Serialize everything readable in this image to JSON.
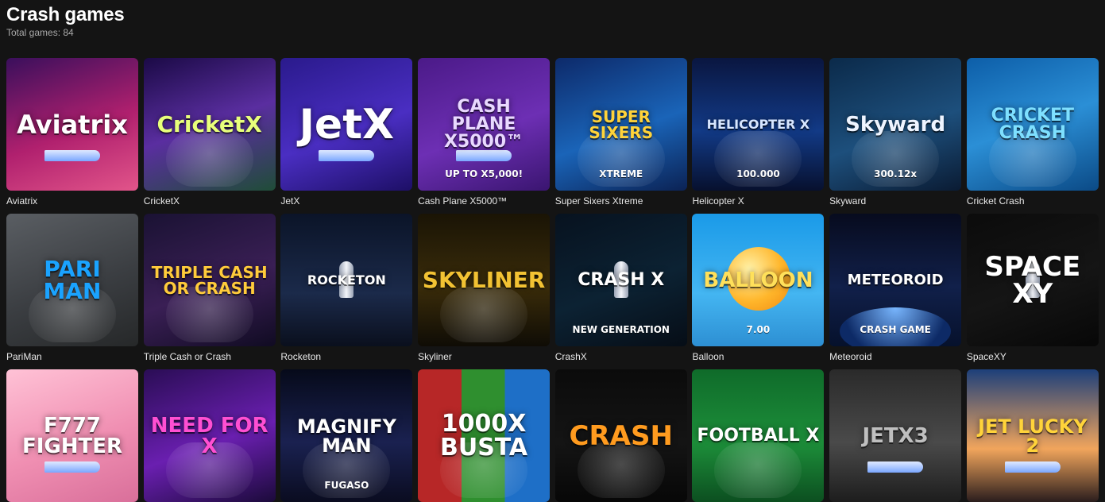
{
  "page": {
    "title": "Crash games",
    "total_label": "Total games: 84"
  },
  "games": [
    {
      "name": "Aviatrix",
      "thumb_text": "Aviatrix",
      "thumb_sub": "",
      "bg": "linear-gradient(160deg,#3a0f5c 0%,#b0206e 55%,#e2558a 100%)",
      "text_color": "#ffffff",
      "font_size": "32px",
      "icon": "plane-icon"
    },
    {
      "name": "CricketX",
      "thumb_text": "CricketX",
      "thumb_sub": "",
      "bg": "linear-gradient(160deg,#1b0a46 0%,#5a2ea0 50%,#1f4d37 100%)",
      "text_color": "#e8ff7a",
      "font_size": "28px",
      "icon": "cricket-bat-icon"
    },
    {
      "name": "JetX",
      "thumb_text": "JetX",
      "thumb_sub": "",
      "bg": "linear-gradient(160deg,#2a1a8c 0%,#4a2ec2 55%,#1d0f66 100%)",
      "text_color": "#ffffff",
      "font_size": "52px",
      "icon": "jet-icon"
    },
    {
      "name": "Cash Plane X5000™",
      "thumb_text": "CASH PLANE X5000™",
      "thumb_sub": "UP TO X5,000!",
      "bg": "linear-gradient(160deg,#4b1a88 0%,#6d2fb4 55%,#3a1570 100%)",
      "text_color": "#e9d9ff",
      "font_size": "22px",
      "icon": "plane-icon"
    },
    {
      "name": "Super Sixers Xtreme",
      "thumb_text": "SUPER SIXERS",
      "thumb_sub": "XTREME",
      "bg": "linear-gradient(160deg,#0d2a6a 0%,#1a64b8 55%,#0b2254 100%)",
      "text_color": "#ffd33a",
      "font_size": "20px",
      "icon": "cricket-ball-icon"
    },
    {
      "name": "Helicopter X",
      "thumb_text": "HELICOPTER X",
      "thumb_sub": "100.000",
      "bg": "linear-gradient(180deg,#0a1640 0%,#123a86 55%,#07102e 100%)",
      "text_color": "#d7e6ff",
      "font_size": "16px",
      "icon": "helicopter-icon"
    },
    {
      "name": "Skyward",
      "thumb_text": "Skyward",
      "thumb_sub": "300.12x",
      "bg": "linear-gradient(160deg,#0b2a4a 0%,#1d4f7c 55%,#0a1b33 100%)",
      "text_color": "#eef4ff",
      "font_size": "26px",
      "icon": "pilot-icon"
    },
    {
      "name": "Cricket Crash",
      "thumb_text": "CRICKET CRASH",
      "thumb_sub": "",
      "bg": "linear-gradient(160deg,#0d5ea8 0%,#2b8fd6 50%,#0b4a86 100%)",
      "text_color": "#7ee0ff",
      "font_size": "22px",
      "icon": "helmet-icon"
    },
    {
      "name": "PariMan",
      "thumb_text": "PARI MAN",
      "thumb_sub": "",
      "bg": "linear-gradient(160deg,#5a5e63 0%,#3b3e42 55%,#262829 100%)",
      "text_color": "#1aa3ff",
      "font_size": "28px",
      "icon": "hero-icon"
    },
    {
      "name": "Triple Cash or Crash",
      "thumb_text": "TRIPLE CASH OR CRASH",
      "thumb_sub": "",
      "bg": "linear-gradient(160deg,#1a1233 0%,#3a1f55 55%,#100b22 100%)",
      "text_color": "#ffcb3b",
      "font_size": "20px",
      "icon": "astronaut-icon"
    },
    {
      "name": "Rocketon",
      "thumb_text": "ROCKETON",
      "thumb_sub": "",
      "bg": "linear-gradient(180deg,#0b1428 0%,#1b2a4a 60%,#0a0f1d 100%)",
      "text_color": "#ffffff",
      "font_size": "16px",
      "icon": "rocket-icon"
    },
    {
      "name": "Skyliner",
      "thumb_text": "SKYLINER",
      "thumb_sub": "",
      "bg": "linear-gradient(180deg,#1a1405 0%,#3a2c0a 55%,#0f0c05 100%)",
      "text_color": "#f2c233",
      "font_size": "28px",
      "icon": "airship-icon"
    },
    {
      "name": "CrashX",
      "thumb_text": "CRASH X",
      "thumb_sub": "NEW GENERATION",
      "bg": "linear-gradient(160deg,#07121f 0%,#0c2233 55%,#060d16 100%)",
      "text_color": "#ffffff",
      "font_size": "22px",
      "icon": "rocket-icon"
    },
    {
      "name": "Balloon",
      "thumb_text": "BALLOON",
      "thumb_sub": "7.00",
      "bg": "linear-gradient(180deg,#1a9ae8 0%,#44b6f2 60%,#2d8fd3 100%)",
      "text_color": "#ffe05a",
      "font_size": "26px",
      "icon": "balloon-icon"
    },
    {
      "name": "Meteoroid",
      "thumb_text": "METEOROID",
      "thumb_sub": "CRASH GAME",
      "bg": "linear-gradient(180deg,#070b1e 0%,#11204a 55%,#06112c 100%)",
      "text_color": "#ffffff",
      "font_size": "18px",
      "icon": "planet-icon"
    },
    {
      "name": "SpaceXY",
      "thumb_text": "SPACE XY",
      "thumb_sub": "",
      "bg": "linear-gradient(160deg,#0b0b0b 0%,#151515 55%,#070707 100%)",
      "text_color": "#ffffff",
      "font_size": "34px",
      "icon": "rocket-icon"
    },
    {
      "name": "F777 Fighter",
      "thumb_text": "F777 FIGHTER",
      "thumb_sub": "",
      "bg": "linear-gradient(160deg,#ffc2d6 0%,#f08fb2 55%,#d96f9a 100%)",
      "text_color": "#ffffff",
      "font_size": "26px",
      "icon": "jet-icon"
    },
    {
      "name": "Need for X",
      "thumb_text": "NEED FOR X",
      "thumb_sub": "",
      "bg": "linear-gradient(160deg,#2a0d55 0%,#6a1fb0 55%,#1b0a3a 100%)",
      "text_color": "#ff4fd2",
      "font_size": "26px",
      "icon": "car-icon"
    },
    {
      "name": "Magnify Man",
      "thumb_text": "MAGNIFY MAN",
      "thumb_sub": "FUGASO",
      "bg": "linear-gradient(180deg,#060a1a 0%,#1a2150 55%,#0a0c20 100%)",
      "text_color": "#ffffff",
      "font_size": "24px",
      "icon": "hero-icon"
    },
    {
      "name": "1000x Busta",
      "thumb_text": "1000X BUSTA",
      "thumb_sub": "",
      "bg": "linear-gradient(90deg,#b72727 0%,#b72727 33%,#2f8f2f 33%,#2f8f2f 66%,#1e6fc7 66%,#1e6fc7 100%)",
      "text_color": "#ffffff",
      "font_size": "30px",
      "icon": "money-icon"
    },
    {
      "name": "Crash",
      "thumb_text": "CRASH",
      "thumb_sub": "",
      "bg": "linear-gradient(180deg,#0b0b0b 0%,#141414 55%,#070707 100%)",
      "text_color": "#ff9b1f",
      "font_size": "34px",
      "icon": "flame-icon"
    },
    {
      "name": "Football X",
      "thumb_text": "FOOTBALL X",
      "thumb_sub": "",
      "bg": "linear-gradient(180deg,#0f6b2a 0%,#1d8f3a 55%,#0c4f20 100%)",
      "text_color": "#ffffff",
      "font_size": "22px",
      "icon": "football-icon"
    },
    {
      "name": "JetX3",
      "thumb_text": "JETX3",
      "thumb_sub": "",
      "bg": "linear-gradient(180deg,#2a2a2a 0%,#4a4a4a 55%,#1d1d1d 100%)",
      "text_color": "#bfbfbf",
      "font_size": "26px",
      "icon": "jet-icon"
    },
    {
      "name": "Jet Lucky 2",
      "thumb_text": "JET LUCKY 2",
      "thumb_sub": "",
      "bg": "linear-gradient(180deg,#1d3f7a 0%,#f1a55c 60%,#2a1d1d 100%)",
      "text_color": "#ffd33a",
      "font_size": "24px",
      "icon": "jet-icon"
    }
  ]
}
